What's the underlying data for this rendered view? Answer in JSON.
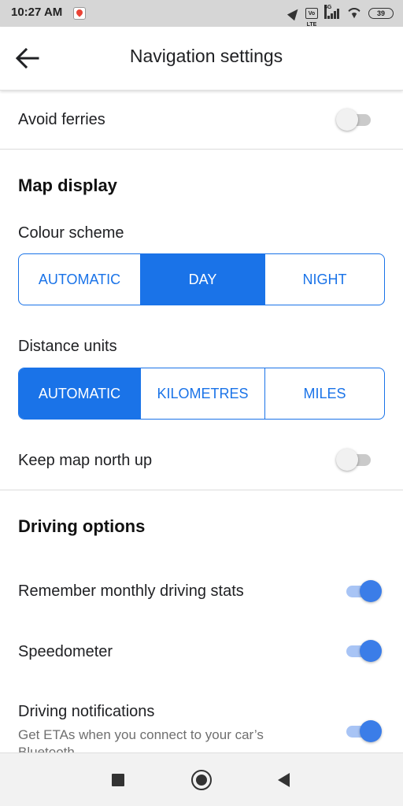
{
  "status_bar": {
    "time": "10:27 AM",
    "icons": [
      "maps-notification-icon",
      "navigation-arrow-icon",
      "volte-icon",
      "signal-4g-icon",
      "wifi-icon",
      "battery-icon"
    ],
    "volte_label": "Vo LTE",
    "network_label": "4G",
    "battery": "39"
  },
  "app_bar": {
    "back_icon": "arrow-back-icon",
    "title": "Navigation settings"
  },
  "rows": {
    "avoid_ferries": {
      "label": "Avoid ferries",
      "on": false
    },
    "keep_north": {
      "label": "Keep map north up",
      "on": false
    },
    "monthly_stats": {
      "label": "Remember monthly driving stats",
      "on": true
    },
    "speedometer": {
      "label": "Speedometer",
      "on": true
    },
    "notifications": {
      "label": "Driving notifications",
      "sub": "Get ETAs when you connect to your car’s",
      "sub_cut": "Bluetooth",
      "on": true
    }
  },
  "map_display": {
    "title": "Map display",
    "colour_scheme": {
      "label": "Colour scheme",
      "options": [
        "AUTOMATIC",
        "DAY",
        "NIGHT"
      ],
      "selected": "DAY"
    },
    "distance_units": {
      "label": "Distance units",
      "options": [
        "AUTOMATIC",
        "KILOMETRES",
        "MILES"
      ],
      "selected": "AUTOMATIC"
    }
  },
  "driving_options": {
    "title": "Driving options"
  },
  "nav_bar": {
    "icons": [
      "recents-square-icon",
      "home-circle-icon",
      "back-triangle-icon"
    ]
  },
  "colors": {
    "accent": "#1a73e8",
    "switch_on": "#3b7de8",
    "switch_on_track": "#a8c4f5",
    "switch_off": "#f1f1f1",
    "status_bar_bg": "#d6d6d6"
  }
}
